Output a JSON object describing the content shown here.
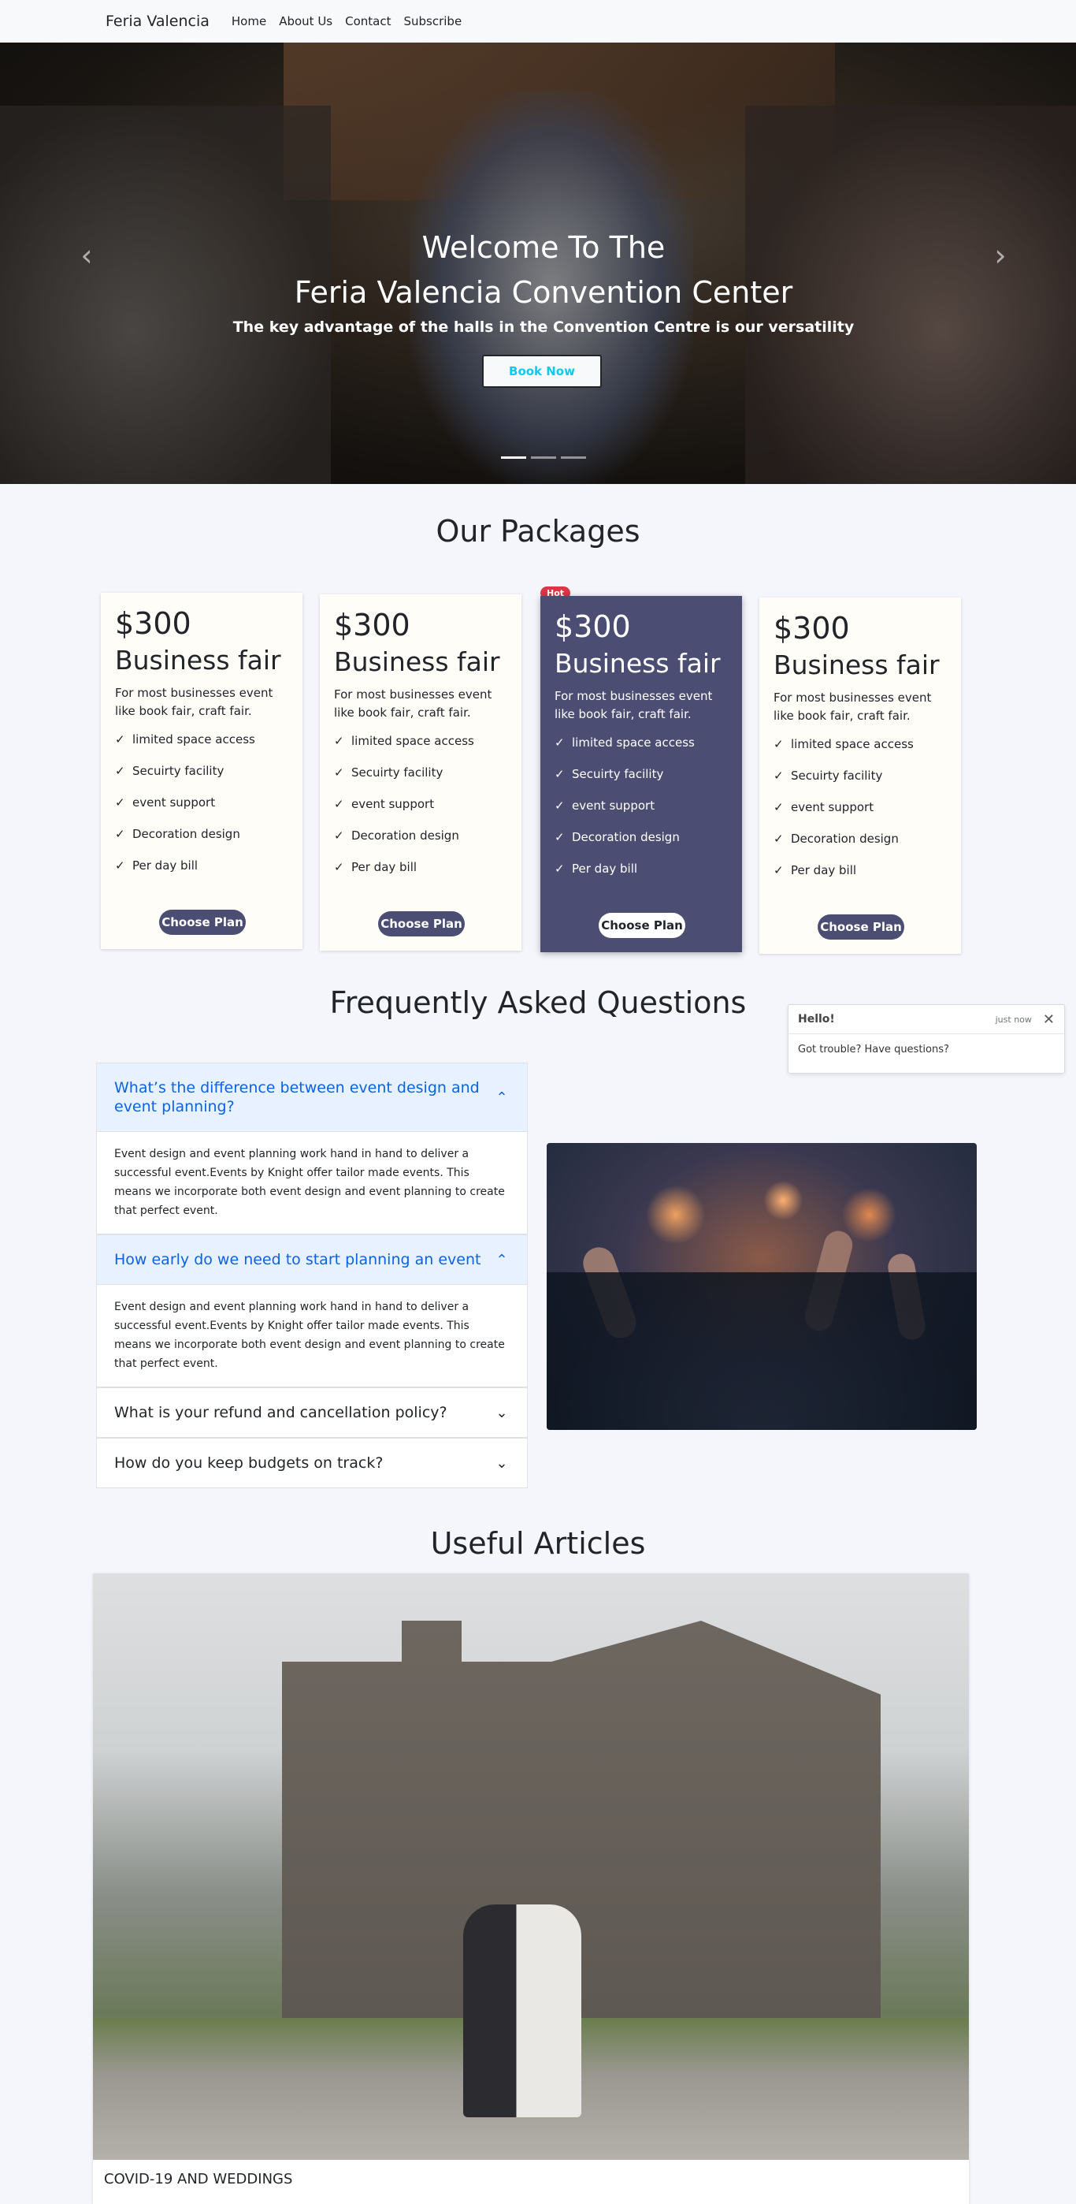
{
  "nav": {
    "brand": "Feria Valencia",
    "links": [
      "Home",
      "About Us",
      "Contact",
      "Subscribe"
    ]
  },
  "hero": {
    "title_line1": "Welcome To The",
    "title_line2": "Feria Valencia Convention Center",
    "subtitle": "The key advantage of the halls in the Convention Centre is our versatility",
    "cta": "Book Now",
    "prev_icon": "chevron-left",
    "next_icon": "chevron-right",
    "slides": 3,
    "active_slide": 1
  },
  "packages": {
    "title": "Our Packages",
    "hot_badge": "Hot",
    "cards": [
      {
        "price": "$300",
        "name": "Business fair",
        "desc": "For most businesses event like book fair, craft fair.",
        "features": [
          "limited space access",
          "Secuirty facility",
          "event support",
          "Decoration design",
          "Per day bill"
        ],
        "cta": "Choose Plan",
        "featured": false
      },
      {
        "price": "$300",
        "name": "Business fair",
        "desc": "For most businesses event like book fair, craft fair.",
        "features": [
          "limited space access",
          "Secuirty facility",
          "event support",
          "Decoration design",
          "Per day bill"
        ],
        "cta": "Choose Plan",
        "featured": false
      },
      {
        "price": "$300",
        "name": "Business fair",
        "desc": "For most businesses event like book fair, craft fair.",
        "features": [
          "limited space access",
          "Secuirty facility",
          "event support",
          "Decoration design",
          "Per day bill"
        ],
        "cta": "Choose Plan",
        "featured": true
      },
      {
        "price": "$300",
        "name": "Business fair",
        "desc": "For most businesses event like book fair, craft fair.",
        "features": [
          "limited space access",
          "Secuirty facility",
          "event support",
          "Decoration design",
          "Per day bill"
        ],
        "cta": "Choose Plan",
        "featured": false
      }
    ]
  },
  "chat": {
    "greeting": "Hello!",
    "time": "just now",
    "message": "Got trouble? Have questions?"
  },
  "faq": {
    "title": "Frequently Asked Questions",
    "items": [
      {
        "question": "What’s the difference between event design and event planning?",
        "answer": "Event design and event planning work hand in hand to deliver a successful event.Events by Knight offer tailor made events. This means we incorporate both event design and event planning to create that perfect event.",
        "open": true
      },
      {
        "question": "How early do we need to start planning an event",
        "answer": "Event design and event planning work hand in hand to deliver a successful event.Events by Knight offer tailor made events. This means we incorporate both event design and event planning to create that perfect event.",
        "open": true
      },
      {
        "question": "What is your refund and cancellation policy?",
        "answer": "",
        "open": false
      },
      {
        "question": "How do you keep budgets on track?",
        "answer": "",
        "open": false
      }
    ]
  },
  "articles": {
    "title": "Useful Articles",
    "items": [
      {
        "title": "COVID-19 AND WEDDINGS"
      }
    ]
  }
}
